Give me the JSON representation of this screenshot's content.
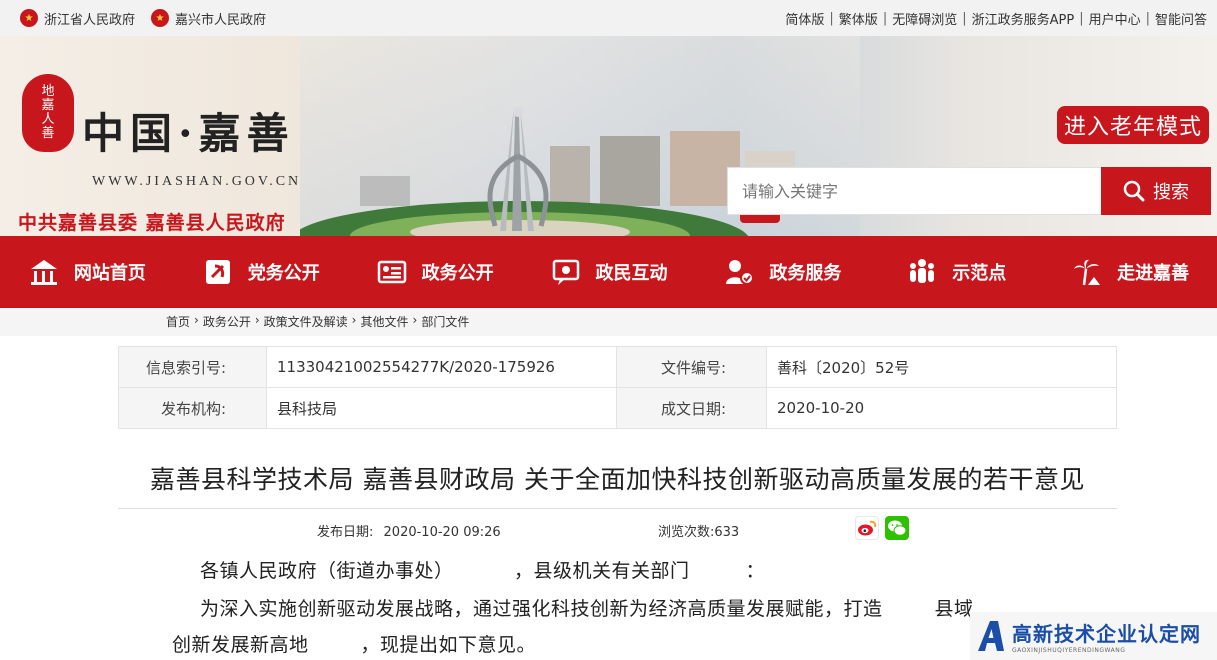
{
  "topbar": {
    "links_left": [
      "浙江省人民政府",
      "嘉兴市人民政府"
    ],
    "links_right": [
      "简体版",
      "繁体版",
      "无障碍浏览",
      "浙江政务服务APP",
      "用户中心",
      "智能问答"
    ]
  },
  "header": {
    "seal_text": [
      "地",
      "嘉",
      "人",
      "善"
    ],
    "site_title": "中国·嘉善",
    "site_url": "WWW.JIASHAN.GOV.CN",
    "subtitle": "中共嘉善县委  嘉善县人民政府",
    "elder_mode": "进入老年模式",
    "search": {
      "placeholder": "请输入关键字",
      "button": "搜索"
    }
  },
  "nav": [
    {
      "label": "网站首页",
      "icon": "home-icon"
    },
    {
      "label": "党务公开",
      "icon": "party-emblem-icon"
    },
    {
      "label": "政务公开",
      "icon": "document-icon"
    },
    {
      "label": "政民互动",
      "icon": "chat-icon"
    },
    {
      "label": "政务服务",
      "icon": "service-icon"
    },
    {
      "label": "示范点",
      "icon": "people-icon"
    },
    {
      "label": "走进嘉善",
      "icon": "palm-tree-icon"
    }
  ],
  "breadcrumb": [
    "首页",
    "政务公开",
    "政策文件及解读",
    "其他文件",
    "部门文件"
  ],
  "meta": {
    "index_label": "信息索引号:",
    "index_value": "11330421002554277K/2020-175926",
    "doc_no_label": "文件编号:",
    "doc_no_value": "善科〔2020〕52号",
    "org_label": "发布机构:",
    "org_value": "县科技局",
    "date_label": "成文日期:",
    "date_value": "2020-10-20"
  },
  "article": {
    "title": "嘉善县科学技术局 嘉善县财政局 关于全面加快科技创新驱动高质量发展的若干意见",
    "published_label": "发布日期:",
    "published_value": "2020-10-20 09:26",
    "views_label": "浏览次数:",
    "views_value": "633",
    "para1_a": "各镇人民政府（街道办事处）",
    "para1_b": "，县级机关有关部门",
    "para1_c": "：",
    "para2_a": "为深入实施创新驱动发展战略，通过强化科技创新为经济高质量发展赋能，打造",
    "para2_b": "县域",
    "para3_a": "创新发展新高地",
    "para3_b": "，现提出如下意见。"
  },
  "watermark": {
    "main": "高新技术企业认定网",
    "sub": "GAOXINJISHUQIYERENDINGWANG"
  },
  "colors": {
    "brand_red": "#c8161d",
    "watermark_blue": "#1a4ea8"
  }
}
